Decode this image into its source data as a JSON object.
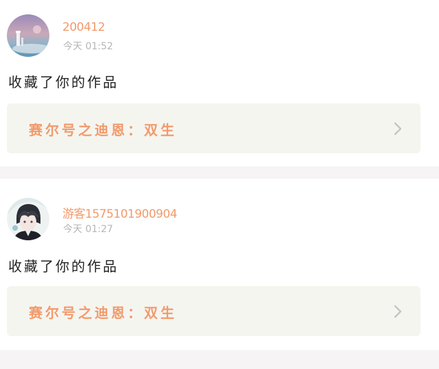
{
  "feed": {
    "items": [
      {
        "username": "200412",
        "timestamp": "今天  01:52",
        "action": "收藏了你的作品",
        "work_title": "赛尔号之迪恩：双生",
        "avatar_icon": "avatar-landscape-icon"
      },
      {
        "username": "游客1575101900904",
        "timestamp": "今天  01:27",
        "action": "收藏了你的作品",
        "work_title": "赛尔号之迪恩：双生",
        "avatar_icon": "avatar-anime-character-icon"
      }
    ]
  },
  "colors": {
    "accent": "#f29a6c",
    "card_background": "#f5f5f0",
    "divider": "#f6f4f4",
    "timestamp": "#b5b5b5",
    "chevron": "#c4c4c4"
  }
}
